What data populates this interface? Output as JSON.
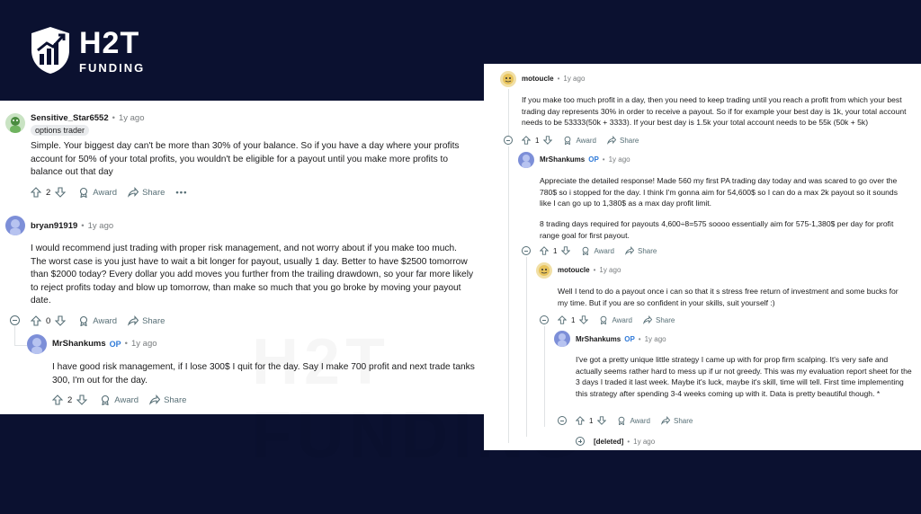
{
  "brand": {
    "name": "H2T",
    "sub": "FUNDING"
  },
  "watermark": "H2T FUNDING",
  "left_panel": {
    "c1": {
      "user": "Sensitive_Star6552",
      "age": "1y ago",
      "flair": "options trader",
      "text": "Simple. Your biggest day can't be more than 30% of your balance. So if you have a day where your profits account for 50% of your total profits, you wouldn't be eligible for a payout until you make more profits to balance out that day",
      "votes": "2",
      "award": "Award",
      "share": "Share",
      "more": "•••"
    },
    "c2": {
      "user": "bryan91919",
      "age": "1y ago",
      "text": "I would recommend just trading with proper risk management, and not worry about if you make too much. The worst case is you just have to wait a bit longer for payout, usually 1 day. Better to have $2500 tomorrow than $2000 today? Every dollar you add moves you further from the trailing drawdown, so your far more likely to reject profits today and blow up tomorrow, than make so much that you go broke by moving your payout date.",
      "votes": "0",
      "award": "Award",
      "share": "Share"
    },
    "c3": {
      "user": "MrShankums",
      "op": "OP",
      "age": "1y ago",
      "text": "I have good risk management, if I lose 300$ I quit for the day. Say I make 700 profit and next trade tanks 300, I'm out for the day.",
      "votes": "2",
      "award": "Award",
      "share": "Share"
    }
  },
  "right_panel": {
    "c1": {
      "user": "motoucle",
      "age": "1y ago",
      "text": "If you make too much profit in a day, then you need to keep trading until you reach a profit from which your best trading day represents 30% in order to receive a payout. So if for example your best day is 1k, your total account needs to be 53333(50k + 3333). If your best day is 1.5k your total account needs to be 55k (50k + 5k)",
      "votes": "1",
      "award": "Award",
      "share": "Share"
    },
    "c2": {
      "user": "MrShankums",
      "op": "OP",
      "age": "1y ago",
      "text1": "Appreciate the detailed response! Made 560 my first PA trading day today and was scared to go over the 780$ so i stopped for the day. I think I'm gonna aim for 54,600$ so I can do a max 2k payout so it sounds like I can go up to 1,380$ as a max day profit limit.",
      "text2": "8 trading days required for payouts 4,600÷8=575 soooo essentially aim for 575-1,380$ per day for profit range goal for first payout.",
      "votes": "1",
      "award": "Award",
      "share": "Share"
    },
    "c3": {
      "user": "motoucle",
      "age": "1y ago",
      "text": "Well I tend to do a payout once i can so that it s stress free return of investment and some bucks for my time. But if you are so confident in your skills, suit yourself :)",
      "votes": "1",
      "award": "Award",
      "share": "Share"
    },
    "c4": {
      "user": "MrShankums",
      "op": "OP",
      "age": "1y ago",
      "text": "I've got a pretty unique little strategy I came up with for prop firm scalping. It's very safe and actually seems rather hard to mess up if ur not greedy. This was my evaluation report sheet for the 3 days I traded it last week. Maybe it's luck, maybe it's skill, time will tell. First time implementing this strategy after spending 3-4 weeks coming up with it. Data is pretty beautiful though. *",
      "votes": "1",
      "award": "Award",
      "share": "Share"
    },
    "c5": {
      "user": "[deleted]",
      "age": "1y ago"
    }
  },
  "colors": {
    "background": "#0b1130",
    "op": "#2f7ad8",
    "muted": "#576f76"
  }
}
